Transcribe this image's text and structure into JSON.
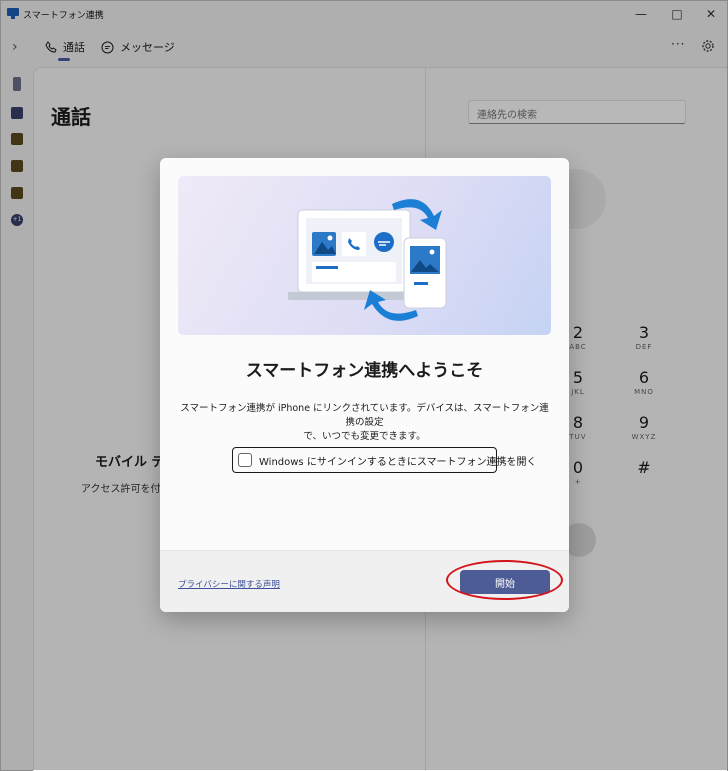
{
  "window": {
    "title": "スマートフォン連携"
  },
  "tabs": [
    {
      "label": "通話",
      "icon": "phone-icon",
      "selected": true
    },
    {
      "label": "メッセージ",
      "icon": "message-icon",
      "selected": false
    }
  ],
  "main": {
    "title": "通話",
    "search_placeholder": "連絡先の検索",
    "left_panel": {
      "heading": "モバイル デ",
      "description": "アクセス許可を付与"
    },
    "dialpad": [
      {
        "digit": "2",
        "letters": "ABC"
      },
      {
        "digit": "3",
        "letters": "DEF"
      },
      {
        "digit": "5",
        "letters": "JKL"
      },
      {
        "digit": "6",
        "letters": "MNO"
      },
      {
        "digit": "8",
        "letters": "TUV"
      },
      {
        "digit": "9",
        "letters": "WXYZ"
      },
      {
        "digit": "0",
        "letters": "+"
      },
      {
        "digit": "#",
        "letters": ""
      }
    ]
  },
  "rail": {
    "badge": "+1"
  },
  "dialog": {
    "title": "スマートフォン連携へようこそ",
    "body_line1": "スマートフォン連携が iPhone にリンクされています。デバイスは、スマートフォン連携の設定",
    "body_line2": "で、いつでも変更できます。",
    "checkbox_label": "Windows にサインインするときにスマートフォン連携を開く",
    "checkbox_checked": false,
    "privacy_link": "プライバシーに関する声明",
    "start_button": "開始"
  },
  "colors": {
    "accent": "#4d5c94",
    "highlight_ring": "#d4141c",
    "link": "#3d4f9a"
  }
}
